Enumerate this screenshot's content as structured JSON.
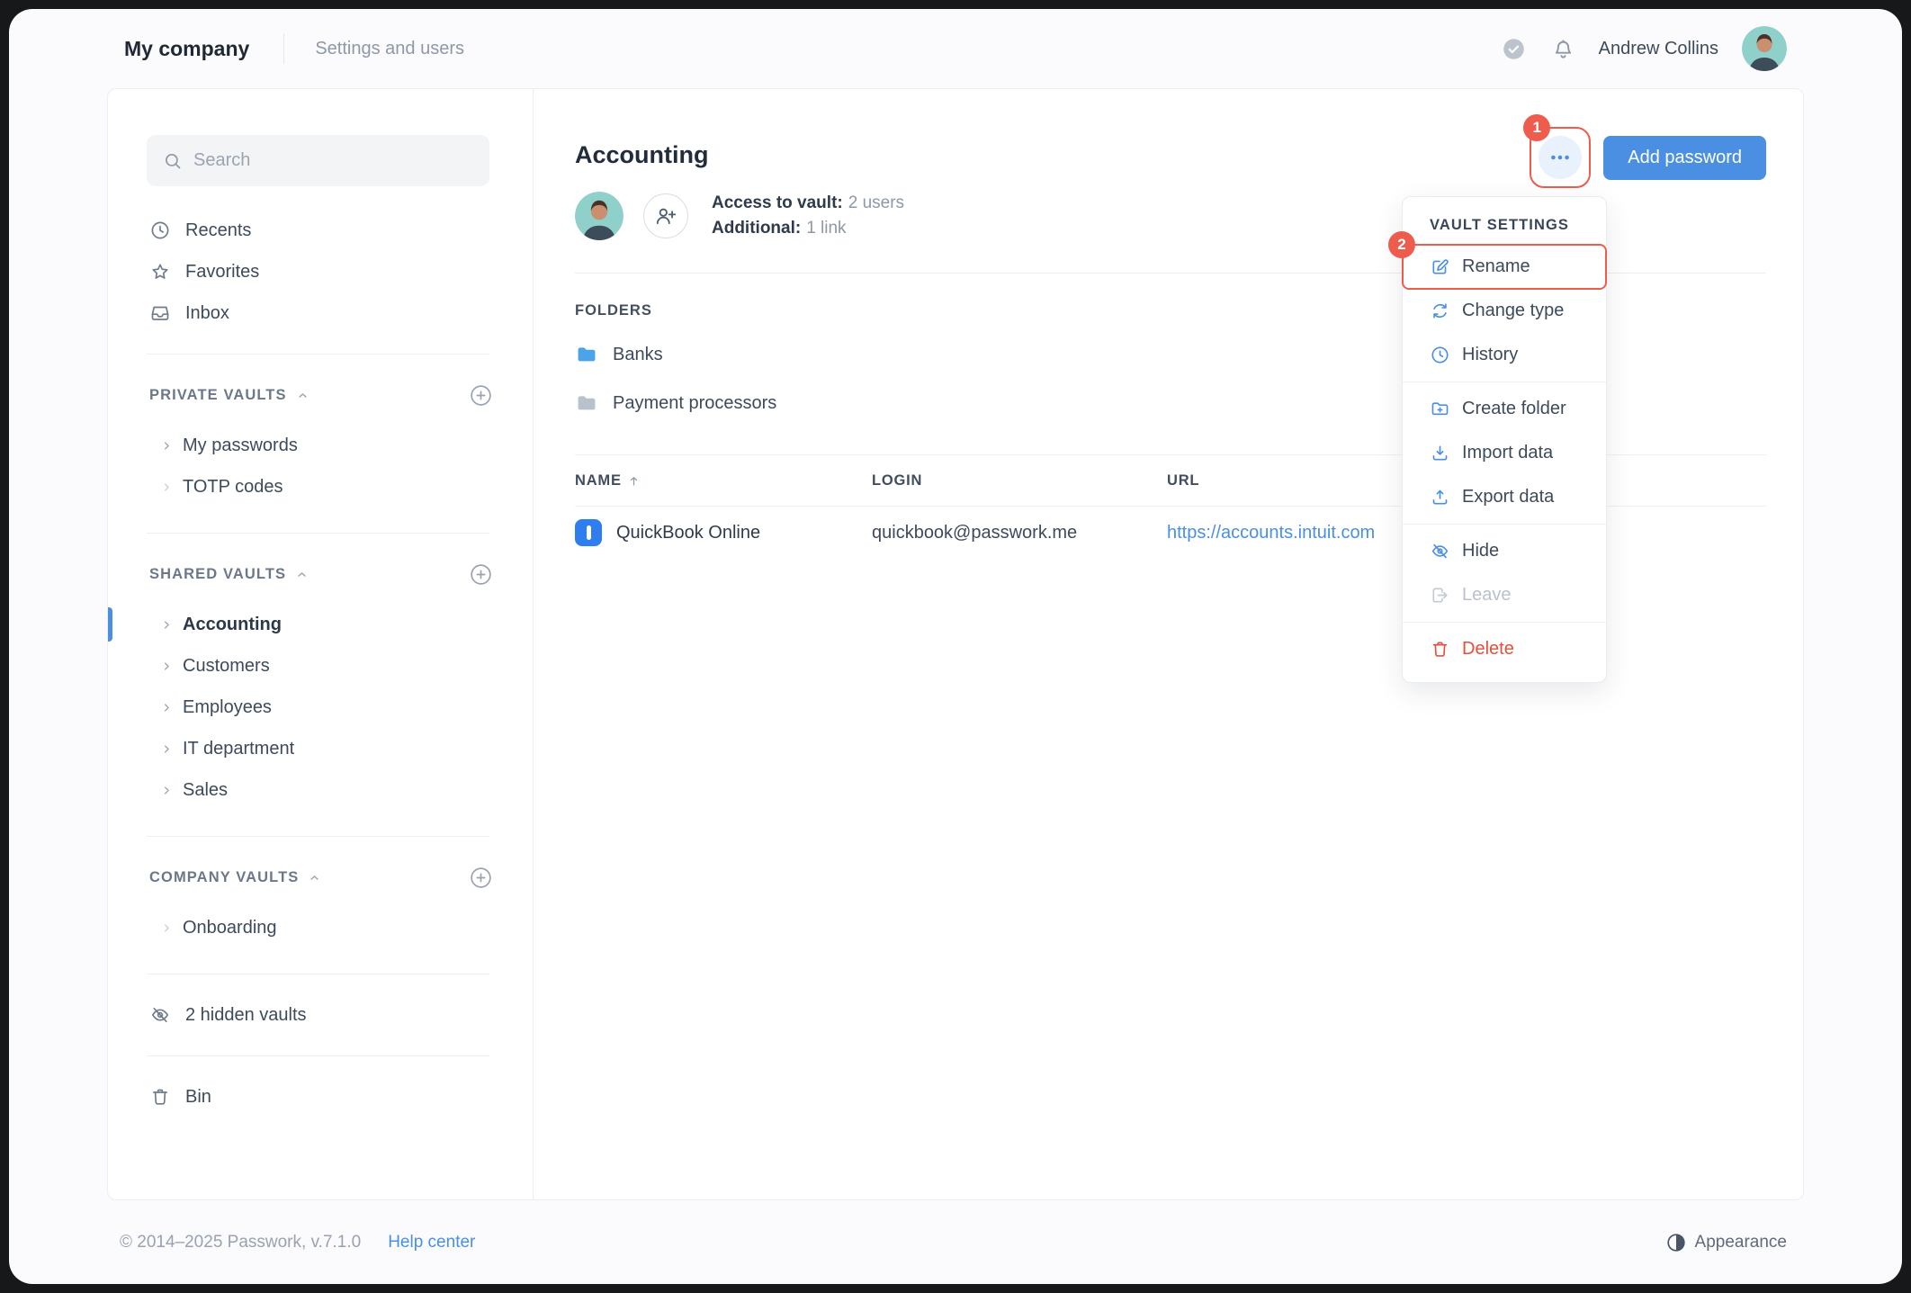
{
  "header": {
    "company": "My company",
    "section": "Settings and users",
    "user": "Andrew Collins"
  },
  "sidebar": {
    "search_placeholder": "Search",
    "nav": [
      {
        "label": "Recents"
      },
      {
        "label": "Favorites"
      },
      {
        "label": "Inbox"
      }
    ],
    "sections": {
      "private": {
        "title": "PRIVATE VAULTS",
        "items": [
          {
            "label": "My passwords"
          },
          {
            "label": "TOTP codes"
          }
        ]
      },
      "shared": {
        "title": "SHARED VAULTS",
        "items": [
          {
            "label": "Accounting"
          },
          {
            "label": "Customers"
          },
          {
            "label": "Employees"
          },
          {
            "label": "IT department"
          },
          {
            "label": "Sales"
          }
        ]
      },
      "company": {
        "title": "COMPANY VAULTS",
        "items": [
          {
            "label": "Onboarding"
          }
        ]
      }
    },
    "hidden_vaults_label": "2 hidden vaults",
    "bin_label": "Bin"
  },
  "main": {
    "title": "Accounting",
    "access_label": "Access to vault:",
    "access_value": "2 users",
    "additional_label": "Additional:",
    "additional_value": "1 link",
    "folders_title": "FOLDERS",
    "folders": [
      {
        "name": "Banks",
        "color": "blue"
      },
      {
        "name": "Payment processors",
        "color": "gray"
      }
    ],
    "table": {
      "headers": {
        "name": "NAME",
        "login": "LOGIN",
        "url": "URL"
      },
      "rows": [
        {
          "name": "QuickBook Online",
          "login": "quickbook@passwork.me",
          "url": "https://accounts.intuit.com"
        }
      ]
    },
    "add_password_label": "Add password"
  },
  "menu": {
    "title": "VAULT SETTINGS",
    "groups": [
      {
        "items": [
          {
            "label": "Rename",
            "icon": "rename-icon",
            "state": "annotated"
          },
          {
            "label": "Change type",
            "icon": "change-type-icon",
            "state": "normal"
          },
          {
            "label": "History",
            "icon": "history-icon",
            "state": "normal"
          }
        ]
      },
      {
        "items": [
          {
            "label": "Create folder",
            "icon": "create-folder-icon",
            "state": "normal"
          },
          {
            "label": "Import data",
            "icon": "import-data-icon",
            "state": "normal"
          },
          {
            "label": "Export data",
            "icon": "export-data-icon",
            "state": "normal"
          }
        ]
      },
      {
        "items": [
          {
            "label": "Hide",
            "icon": "hide-icon",
            "state": "normal"
          },
          {
            "label": "Leave",
            "icon": "leave-icon",
            "state": "disabled"
          }
        ]
      },
      {
        "items": [
          {
            "label": "Delete",
            "icon": "delete-icon",
            "state": "danger"
          }
        ]
      }
    ]
  },
  "annotations": {
    "step1": "1",
    "step2": "2"
  },
  "footer": {
    "copyright": "© 2014–2025 Passwork, v.7.1.0",
    "help": "Help center",
    "appearance": "Appearance"
  },
  "colors": {
    "accent_blue": "#4a8fe2",
    "annotation_red": "#ee5c4d",
    "danger_red": "#e2503c",
    "folder_blue": "#4ba4ea",
    "folder_gray": "#b9c1cc",
    "quickbook_blue": "#2e7ef0"
  }
}
